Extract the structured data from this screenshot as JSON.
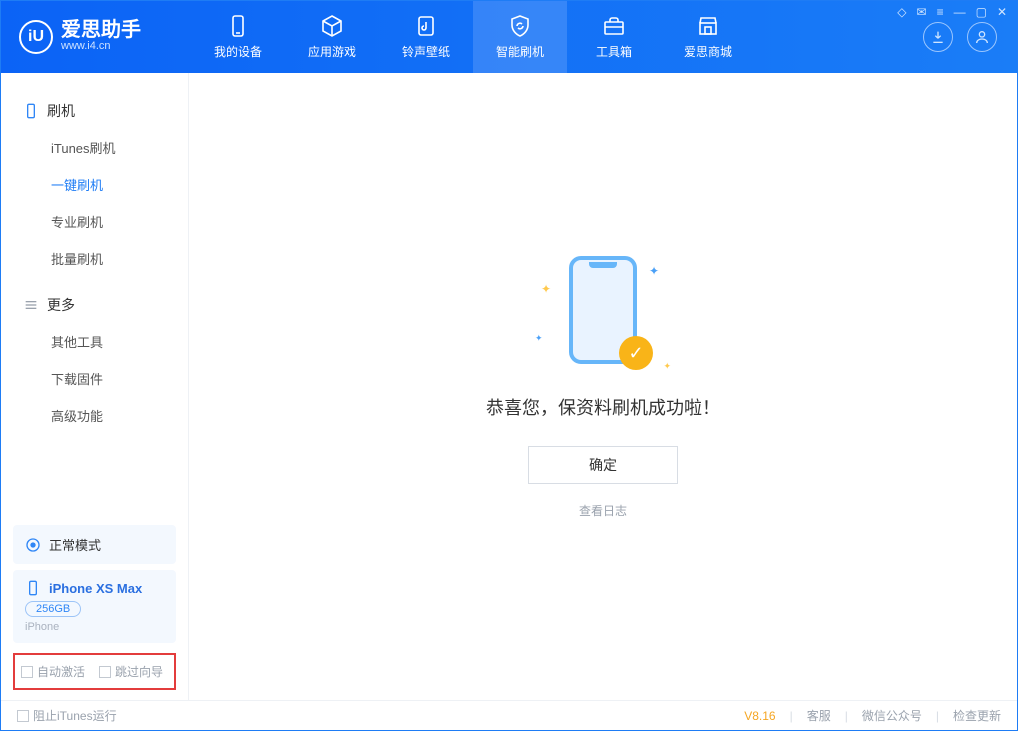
{
  "app": {
    "name": "爱思助手",
    "url": "www.i4.cn"
  },
  "nav": {
    "items": [
      {
        "label": "我的设备"
      },
      {
        "label": "应用游戏"
      },
      {
        "label": "铃声壁纸"
      },
      {
        "label": "智能刷机"
      },
      {
        "label": "工具箱"
      },
      {
        "label": "爱思商城"
      }
    ]
  },
  "sidebar": {
    "section_flash": "刷机",
    "flash_items": [
      {
        "label": "iTunes刷机"
      },
      {
        "label": "一键刷机"
      },
      {
        "label": "专业刷机"
      },
      {
        "label": "批量刷机"
      }
    ],
    "section_more": "更多",
    "more_items": [
      {
        "label": "其他工具"
      },
      {
        "label": "下载固件"
      },
      {
        "label": "高级功能"
      }
    ],
    "mode_card": {
      "label": "正常模式"
    },
    "device_card": {
      "name": "iPhone XS Max",
      "capacity": "256GB",
      "type": "iPhone"
    },
    "opt_auto_activate": "自动激活",
    "opt_skip_guide": "跳过向导"
  },
  "main": {
    "success_text": "恭喜您，保资料刷机成功啦！",
    "ok_button": "确定",
    "view_log": "查看日志"
  },
  "statusbar": {
    "prevent_itunes": "阻止iTunes运行",
    "version": "V8.16",
    "support": "客服",
    "wechat": "微信公众号",
    "check_update": "检查更新"
  }
}
